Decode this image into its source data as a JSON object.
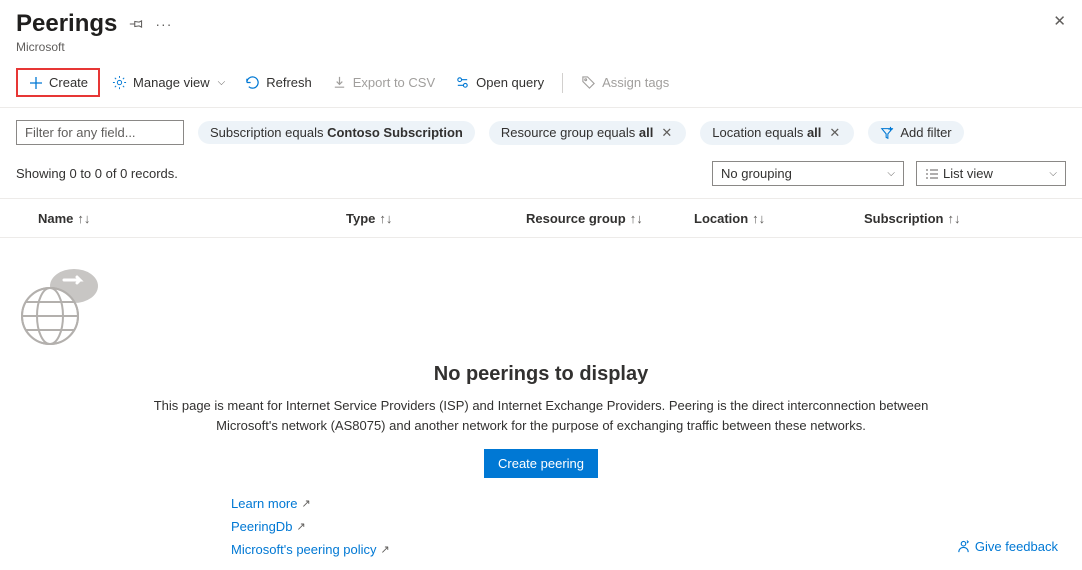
{
  "header": {
    "title": "Peerings",
    "subtitle": "Microsoft"
  },
  "toolbar": {
    "create": "Create",
    "manage_view": "Manage view",
    "refresh": "Refresh",
    "export_csv": "Export to CSV",
    "open_query": "Open query",
    "assign_tags": "Assign tags"
  },
  "filters": {
    "placeholder": "Filter for any field...",
    "pill_sub_prefix": "Subscription equals ",
    "pill_sub_value": "Contoso Subscription",
    "pill_rg_prefix": "Resource group equals ",
    "pill_rg_value": "all",
    "pill_loc_prefix": "Location equals ",
    "pill_loc_value": "all",
    "add_filter": "Add filter"
  },
  "status": {
    "records": "Showing 0 to 0 of 0 records.",
    "grouping": "No grouping",
    "view": "List view"
  },
  "columns": {
    "name": "Name",
    "type": "Type",
    "rg": "Resource group",
    "location": "Location",
    "subscription": "Subscription"
  },
  "empty": {
    "title": "No peerings to display",
    "desc": "This page is meant for Internet Service Providers (ISP) and Internet Exchange Providers. Peering is the direct interconnection between Microsoft's network (AS8075) and another network for the purpose of exchanging traffic between these networks.",
    "button": "Create peering",
    "links": {
      "learn_more": "Learn more",
      "peeringdb": "PeeringDb",
      "policy": "Microsoft's peering policy"
    }
  },
  "feedback": "Give feedback"
}
